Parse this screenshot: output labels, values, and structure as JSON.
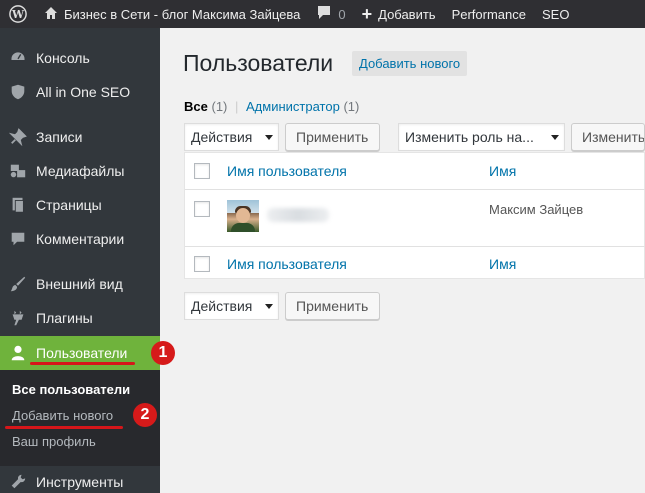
{
  "adminbar": {
    "site_name": "Бизнес в Сети - блог Максима Зайцева",
    "comment_count": "0",
    "add_new": "Добавить",
    "performance": "Performance",
    "seo": "SEO"
  },
  "sidebar": {
    "items": [
      {
        "label": "Консоль",
        "icon": "dashboard-icon"
      },
      {
        "label": "All in One SEO",
        "icon": "shield-icon"
      },
      {
        "label": "Записи",
        "icon": "pin-icon"
      },
      {
        "label": "Медиафайлы",
        "icon": "media-icon"
      },
      {
        "label": "Страницы",
        "icon": "pages-icon"
      },
      {
        "label": "Комментарии",
        "icon": "comment-icon"
      },
      {
        "label": "Внешний вид",
        "icon": "brush-icon"
      },
      {
        "label": "Плагины",
        "icon": "plugin-icon"
      },
      {
        "label": "Пользователи",
        "icon": "user-icon"
      },
      {
        "label": "Инструменты",
        "icon": "wrench-icon"
      }
    ],
    "submenu": [
      "Все пользователи",
      "Добавить нового",
      "Ваш профиль"
    ]
  },
  "annotations": {
    "badge1": "1",
    "badge2": "2",
    "color": "#d6161a"
  },
  "main": {
    "title": "Пользователи",
    "add_new": "Добавить нового",
    "filters": {
      "all": "Все",
      "all_count": "(1)",
      "admin": "Администратор",
      "admin_count": "(1)",
      "sep": "|"
    },
    "bulk_action": "Действия",
    "apply": "Применить",
    "change_role": "Изменить роль на...",
    "change_button": "Изменить",
    "table": {
      "col_username": "Имя пользователя",
      "col_name": "Имя",
      "rows": [
        {
          "name": "Максим Зайцев"
        }
      ]
    }
  },
  "colors": {
    "sidebar": "#32373c",
    "active": "#6fb33c",
    "link": "#0073aa",
    "adminbar": "#2f2f33"
  }
}
